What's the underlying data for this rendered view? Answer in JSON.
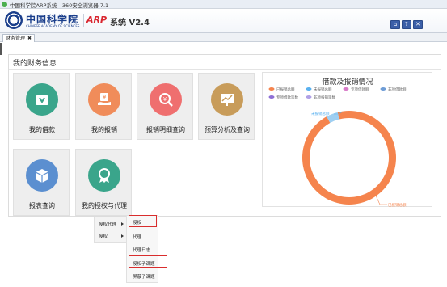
{
  "browser": {
    "title": "中国科学院ARP系统 - 360安全浏览器 7.1"
  },
  "header": {
    "org_name": "中国科学院",
    "org_sub": "CHINESE ACADEMY OF SCIENCES",
    "arp": "ARP",
    "system_label": "系统 V2.4",
    "buttons": [
      {
        "icon": "home-icon",
        "label": "⌂"
      },
      {
        "icon": "help-icon",
        "label": "?"
      },
      {
        "icon": "exit-icon",
        "label": "✕"
      }
    ]
  },
  "tabs": [
    {
      "label": "财务管理",
      "close": "✖"
    }
  ],
  "panel": {
    "title": "我的财务信息",
    "tiles": [
      {
        "label": "我的借款",
        "color": "#3aa58b",
        "icon": "wallet-icon"
      },
      {
        "label": "我的报销",
        "color": "#f08c5a",
        "icon": "reimburse-icon"
      },
      {
        "label": "报销明细查询",
        "color": "#ef6f6f",
        "icon": "search-yen-icon"
      },
      {
        "label": "预算分析及查询",
        "color": "#c89c5a",
        "icon": "chart-board-icon"
      },
      {
        "label": "报表查询",
        "color": "#5b8fd0",
        "icon": "box-icon"
      },
      {
        "label": "我的授权与代理",
        "color": "#3aa58b",
        "icon": "award-icon"
      }
    ]
  },
  "chart_data": {
    "type": "pie",
    "title": "借款及报销情况",
    "legend": [
      {
        "name": "已报销总额",
        "color": "#f5844d"
      },
      {
        "name": "未报销总额",
        "color": "#5ab1ef"
      },
      {
        "name": "专项借款额",
        "color": "#d87ac8"
      },
      {
        "name": "非项借款额",
        "color": "#6f9dd6"
      },
      {
        "name": "专项借款笔数",
        "color": "#8e6fd6"
      },
      {
        "name": "非项报销笔数",
        "color": "#b0a0e6"
      }
    ],
    "slices": [
      {
        "name": "已报销总额",
        "value": 0.96,
        "color": "#f5844d"
      },
      {
        "name": "未报销总额",
        "value": 0.04,
        "color": "#9ecff2"
      }
    ],
    "slice_labels": [
      "未报销总额",
      "已报销总额"
    ],
    "legend_position": "top"
  },
  "menu": {
    "items": [
      {
        "label": "授权代理"
      },
      {
        "label": "授权"
      }
    ],
    "submenu": [
      {
        "label": "授权",
        "highlighted": true
      },
      {
        "label": "代理",
        "highlighted": false
      },
      {
        "label": "代理日志",
        "highlighted": false
      },
      {
        "label": "授权子课题",
        "highlighted": true
      },
      {
        "label": "屏蔽子课题",
        "highlighted": false
      }
    ]
  }
}
